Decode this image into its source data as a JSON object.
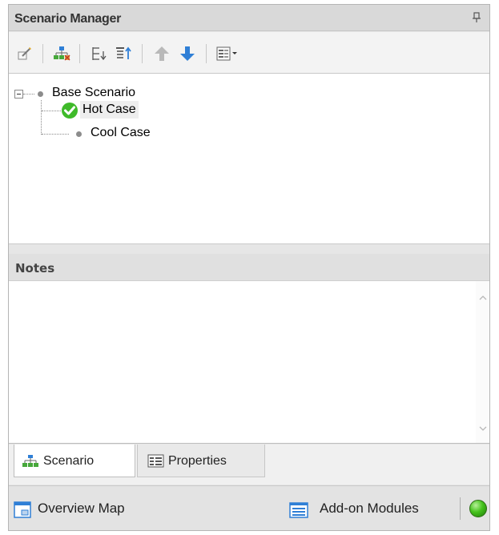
{
  "panel": {
    "title": "Scenario Manager",
    "pin_icon": "pin-icon"
  },
  "toolbar": {
    "buttons": [
      {
        "name": "edit-scenario-button",
        "icon": "edit-scenario-icon"
      },
      {
        "name": "create-child-scenario-button",
        "icon": "scenario-tree-icon"
      },
      {
        "name": "collapse-tree-button",
        "icon": "collapse-tree-icon"
      },
      {
        "name": "expand-tree-button",
        "icon": "expand-tree-icon"
      },
      {
        "name": "move-up-button",
        "icon": "arrow-up-icon"
      },
      {
        "name": "move-down-button",
        "icon": "arrow-down-icon"
      },
      {
        "name": "view-options-dropdown",
        "icon": "view-options-icon"
      }
    ]
  },
  "tree": {
    "root": {
      "label": "Base Scenario",
      "expanded": true
    },
    "children": [
      {
        "label": "Hot Case",
        "current": true,
        "selected": true
      },
      {
        "label": "Cool Case",
        "current": false,
        "selected": false
      }
    ]
  },
  "notes": {
    "header": "Notes",
    "content": ""
  },
  "tabs": [
    {
      "label": "Scenario",
      "active": true,
      "icon": "scenario-tree-icon"
    },
    {
      "label": "Properties",
      "active": false,
      "icon": "properties-grid-icon"
    }
  ],
  "statusbar": {
    "overview_label": "Overview Map",
    "addon_label": "Add-on Modules",
    "status_light": "green",
    "colors": {
      "status_ok": "#45c21c",
      "accent_blue": "#2f7fd6"
    }
  }
}
